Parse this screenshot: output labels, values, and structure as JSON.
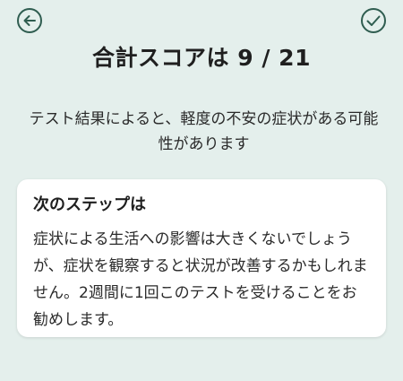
{
  "header": {
    "back_icon": "arrow-left-circle-icon",
    "done_icon": "check-circle-icon",
    "accent_color": "#2f5d50"
  },
  "result": {
    "score_title": "合計スコアは 9 / 21",
    "message": "テスト結果によると、軽度の不安の症状がある可能性があります"
  },
  "next_steps": {
    "title": "次のステップは",
    "body": "症状による生活への影響は大きくないでしょうが、症状を観察すると状況が改善するかもしれません。2週間に1回このテストを受けることをお勧めします。"
  }
}
